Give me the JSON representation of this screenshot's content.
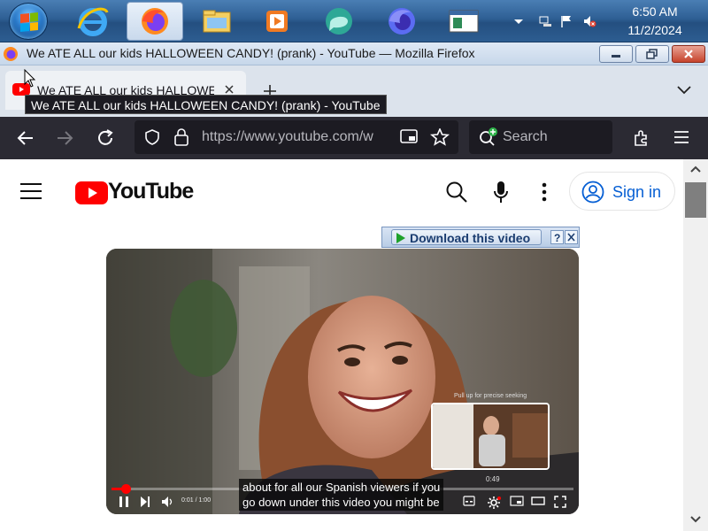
{
  "taskbar": {
    "apps": [
      {
        "name": "internet-explorer"
      },
      {
        "name": "firefox",
        "active": true
      },
      {
        "name": "file-explorer"
      },
      {
        "name": "media-player"
      },
      {
        "name": "chat-app"
      },
      {
        "name": "firefox-alt"
      },
      {
        "name": "window-app"
      }
    ],
    "clock": {
      "time": "6:50 AM",
      "date": "11/2/2024"
    }
  },
  "window": {
    "title": "We ATE ALL our kids HALLOWEEN CANDY! (prank) - YouTube — Mozilla Firefox"
  },
  "tabs": {
    "active_title": "We ATE ALL our kids HALLOWEEN CANDY! (prank) - YouTube",
    "tooltip": "We ATE ALL our kids HALLOWEEN CANDY! (prank) - YouTube"
  },
  "navbar": {
    "url": "https://www.youtube.com/w",
    "search_placeholder": "Search"
  },
  "youtube": {
    "logo_text": "YouTube",
    "signin_label": "Sign in",
    "download_label": "Download this video"
  },
  "video": {
    "caption": "about for all our Spanish viewers if you\ngo down under this video you might be",
    "time": "0:01 / 1:00",
    "progress": 0.03,
    "preview_label": "Pull up for precise seeking",
    "preview_time": "0:49"
  },
  "colors": {
    "youtube_red": "#ff0000",
    "signin_blue": "#065fd4",
    "firefox_toolbar": "#2b2a33"
  }
}
